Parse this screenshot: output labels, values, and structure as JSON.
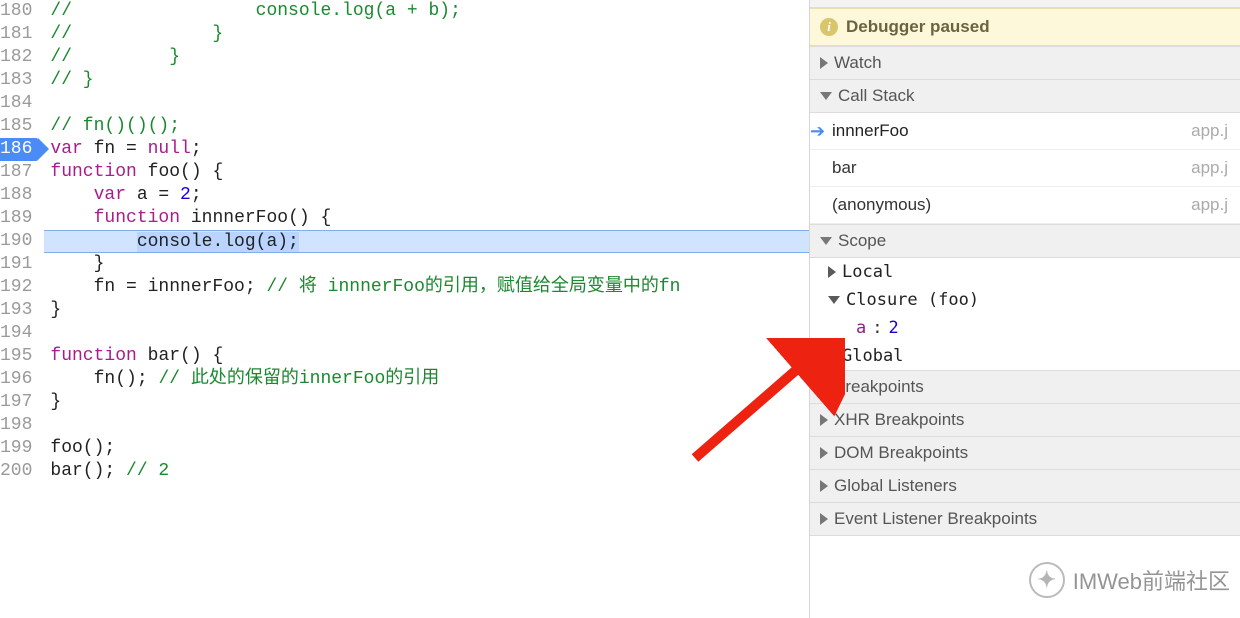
{
  "editor": {
    "lines": [
      {
        "n": 180,
        "html": "<span class='tok-comment'>//                 console.log(a + b);</span>"
      },
      {
        "n": 181,
        "html": "<span class='tok-comment'>//             }</span>"
      },
      {
        "n": 182,
        "html": "<span class='tok-comment'>//         }</span>"
      },
      {
        "n": 183,
        "html": "<span class='tok-comment'>// }</span>"
      },
      {
        "n": 184,
        "html": ""
      },
      {
        "n": 185,
        "html": "<span class='tok-comment'>// fn()()();</span>"
      },
      {
        "n": 186,
        "html": "<span class='tok-kw'>var</span> fn = <span class='tok-null'>null</span>;",
        "breakpoint": true
      },
      {
        "n": 187,
        "html": "<span class='tok-kw'>function</span> <span class='tok-fn'>foo</span>() {"
      },
      {
        "n": 188,
        "html": "    <span class='tok-kw'>var</span> a = <span class='tok-num'>2</span>;"
      },
      {
        "n": 189,
        "html": "    <span class='tok-kw'>function</span> <span class='tok-fn'>innnerFoo</span>() {"
      },
      {
        "n": 190,
        "html": "        <span class='hl'>console.log(a);</span>",
        "exec": true
      },
      {
        "n": 191,
        "html": "    }"
      },
      {
        "n": 192,
        "html": "    fn = innnerFoo; <span class='tok-comment'>// 将 innnerFoo的引用，赋值给全局变量中的fn</span>"
      },
      {
        "n": 193,
        "html": "}"
      },
      {
        "n": 194,
        "html": ""
      },
      {
        "n": 195,
        "html": "<span class='tok-kw'>function</span> <span class='tok-fn'>bar</span>() {"
      },
      {
        "n": 196,
        "html": "    fn(); <span class='tok-comment'>// 此处的保留的innerFoo的引用</span>"
      },
      {
        "n": 197,
        "html": "}"
      },
      {
        "n": 198,
        "html": ""
      },
      {
        "n": 199,
        "html": "foo();"
      },
      {
        "n": 200,
        "html": "bar(); <span class='tok-comment'>// 2</span>"
      }
    ]
  },
  "debugger": {
    "paused_label": "Debugger paused",
    "sections": {
      "watch": "Watch",
      "callstack": "Call Stack",
      "scope": "Scope",
      "breakpoints": "Breakpoints",
      "xhr": "XHR Breakpoints",
      "dom": "DOM Breakpoints",
      "listeners": "Global Listeners",
      "event": "Event Listener Breakpoints"
    },
    "callstack": [
      {
        "name": "innnerFoo",
        "src": "app.j",
        "current": true
      },
      {
        "name": "bar",
        "src": "app.j"
      },
      {
        "name": "(anonymous)",
        "src": "app.j"
      }
    ],
    "scopes": {
      "local_label": "Local",
      "closure_label": "Closure (foo)",
      "closure_var_name": "a",
      "closure_var_sep": ": ",
      "closure_var_val": "2",
      "global_label": "Global"
    }
  },
  "watermark": {
    "text": "IMWeb前端社区"
  }
}
